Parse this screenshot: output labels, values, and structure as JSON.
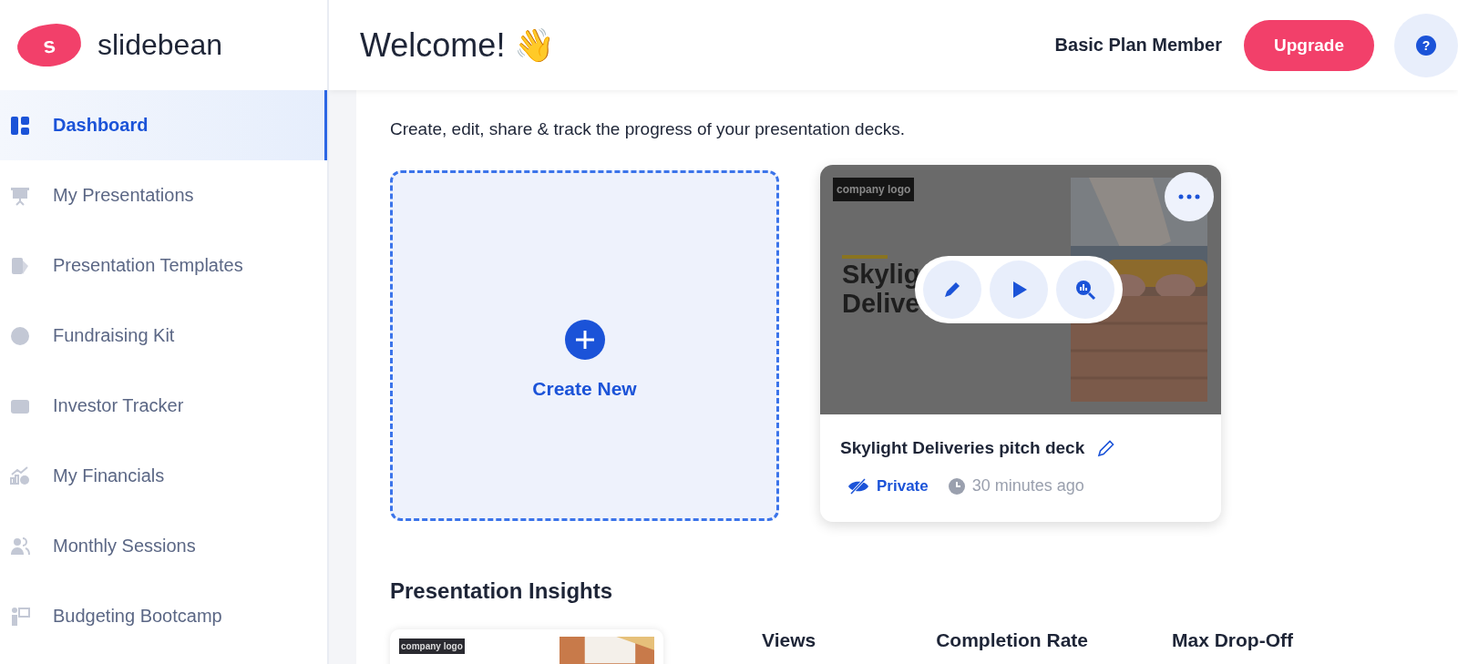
{
  "logo": {
    "mark": "s",
    "name": "slidebean"
  },
  "header": {
    "title": "Welcome! 👋",
    "plan": "Basic Plan Member",
    "upgrade": "Upgrade",
    "help": "?"
  },
  "sidebar": {
    "items": [
      {
        "label": "Dashboard",
        "selected": true
      },
      {
        "label": "My Presentations",
        "selected": false
      },
      {
        "label": "Presentation Templates",
        "selected": false
      },
      {
        "label": "Fundraising Kit",
        "selected": false
      },
      {
        "label": "Investor Tracker",
        "selected": false
      },
      {
        "label": "My Financials",
        "selected": false
      },
      {
        "label": "Monthly Sessions",
        "selected": false
      },
      {
        "label": "Budgeting Bootcamp",
        "selected": false
      }
    ]
  },
  "presentations": {
    "subtitle": "Create, edit, share & track the progress of your presentation decks.",
    "create_new": "Create New",
    "decks": [
      {
        "slide_logo": "company logo",
        "slide_title_lines": [
          "Skylig",
          "Delive"
        ],
        "name": "Skylight Deliveries pitch deck",
        "visibility": "Private",
        "updated": "30 minutes ago"
      }
    ]
  },
  "insights": {
    "heading": "Presentation Insights",
    "slide_logo": "company logo",
    "columns": [
      "Views",
      "Completion Rate",
      "Max Drop-Off"
    ]
  }
}
